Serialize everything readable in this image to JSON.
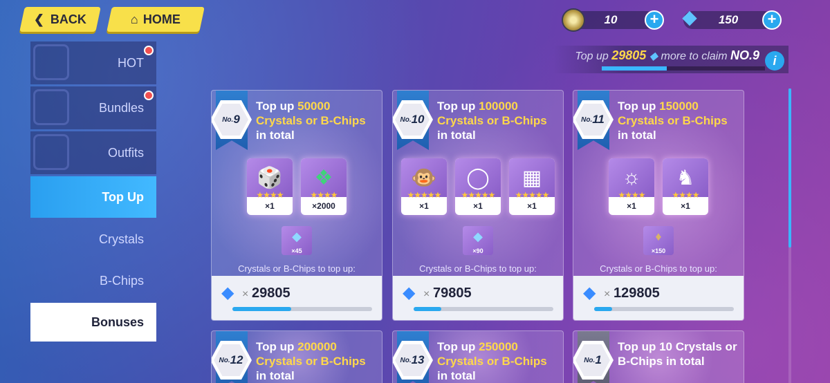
{
  "nav": {
    "back_label": "BACK",
    "home_label": "HOME"
  },
  "currency": {
    "coins": "10",
    "crystals": "150"
  },
  "claim": {
    "prefix": "Top up",
    "amount": "29805",
    "middle": "more to claim",
    "target": "NO.9",
    "progress": 0.4
  },
  "sidebar": {
    "items": [
      {
        "label": "HOT"
      },
      {
        "label": "Bundles"
      },
      {
        "label": "Outfits"
      },
      {
        "label": "Top Up"
      },
      {
        "label": "Crystals"
      },
      {
        "label": "B-Chips"
      },
      {
        "label": "Bonuses"
      }
    ]
  },
  "cards": [
    {
      "no": "9",
      "title_pre": "Top up",
      "amount": "50000",
      "line2": "Crystals or B-Chips",
      "line3": "in total",
      "rewards": [
        {
          "count": "×1"
        },
        {
          "count": "×2000"
        }
      ],
      "extra": "×45",
      "topup_label": "Crystals or B-Chips to top up:",
      "x": "×",
      "remaining": "29805",
      "progress": 0.42
    },
    {
      "no": "10",
      "title_pre": "Top up",
      "amount": "100000",
      "line2": "Crystals or B-Chips",
      "line3": "in total",
      "rewards": [
        {
          "count": "×1"
        },
        {
          "count": "×1"
        },
        {
          "count": "×1"
        }
      ],
      "extra": "×90",
      "topup_label": "Crystals or B-Chips to top up:",
      "x": "×",
      "remaining": "79805",
      "progress": 0.2
    },
    {
      "no": "11",
      "title_pre": "Top up",
      "amount": "150000",
      "line2": "Crystals or B-Chips",
      "line3": "in total",
      "rewards": [
        {
          "count": "×1"
        },
        {
          "count": "×1"
        }
      ],
      "extra": "×150",
      "topup_label": "Crystals or B-Chips to top up:",
      "x": "×",
      "remaining": "129805",
      "progress": 0.13
    },
    {
      "no": "12",
      "title_pre": "Top up",
      "amount": "200000",
      "line2": "Crystals or B-Chips",
      "line3": "in total"
    },
    {
      "no": "13",
      "title_pre": "Top up",
      "amount": "250000",
      "line2": "Crystals or B-Chips",
      "line3": "in total"
    },
    {
      "no": "1",
      "line1": "Top up 10 Crystals or",
      "line2": "B-Chips in total"
    }
  ]
}
